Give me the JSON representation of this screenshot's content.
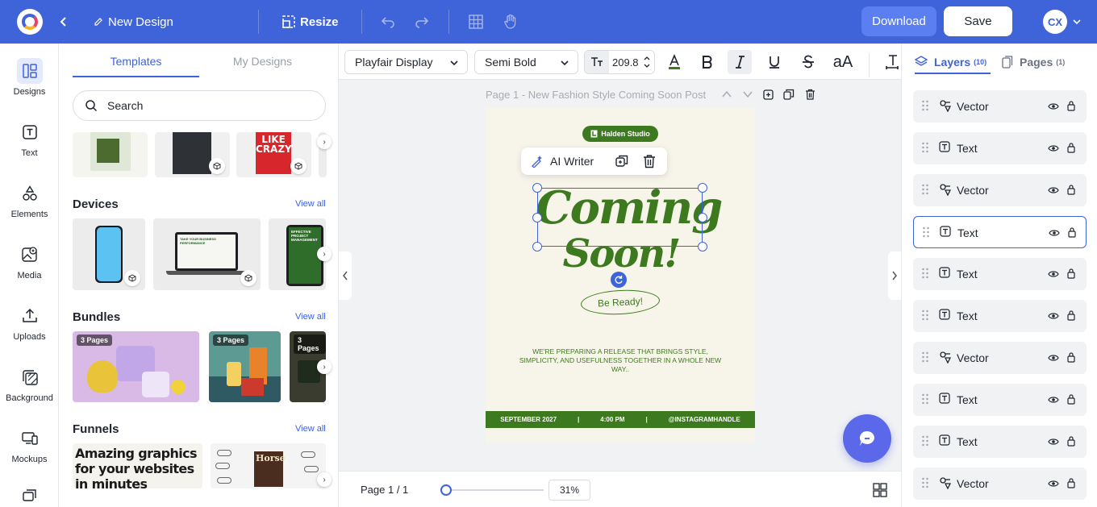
{
  "topbar": {
    "title": "New Design",
    "resize_label": "Resize",
    "download_label": "Download",
    "save_label": "Save",
    "avatar_initials": "CX"
  },
  "leftnav": {
    "items": [
      {
        "label": "Designs",
        "icon": "designs-icon"
      },
      {
        "label": "Text",
        "icon": "text-icon"
      },
      {
        "label": "Elements",
        "icon": "elements-icon"
      },
      {
        "label": "Media",
        "icon": "media-icon"
      },
      {
        "label": "Uploads",
        "icon": "upload-icon"
      },
      {
        "label": "Background",
        "icon": "background-icon"
      },
      {
        "label": "Mockups",
        "icon": "mockups-icon"
      }
    ]
  },
  "panel": {
    "tabs": [
      "Templates",
      "My Designs"
    ],
    "search_placeholder": "Search",
    "sections": {
      "devices": "Devices",
      "bundles": "Bundles",
      "funnels": "Funnels",
      "view_all": "View all"
    },
    "book_thumb_text": "LIKE CRAZY",
    "device_texts": [
      "TAKE YOUR BUSINESS PERFORMANCE",
      "EFFECTIVE PROJECT MANAGEMENT"
    ],
    "bundle_badge": "3 Pages",
    "funnel_text_1": "Amazing graphics for your websites in minutes",
    "funnel_text_2": "Horse"
  },
  "toolbar": {
    "font_family": "Playfair Display",
    "font_weight": "Semi Bold",
    "font_size": "209.8",
    "case_label": "aA"
  },
  "canvas": {
    "page_label": "Page 1 - New Fashion Style Coming Soon Post",
    "ai_writer_label": "AI Writer",
    "poster": {
      "studio": "Halden Studio",
      "line1": "Coming",
      "line2": "Soon!",
      "ready": "Be Ready!",
      "description": "WE'RE PREPARING A RELEASE THAT BRINGS STYLE, SIMPLICITY, AND USEFULNESS TOGETHER IN A WHOLE NEW WAY..",
      "footer": [
        "SEPTEMBER 2027",
        "|",
        "4:00 PM",
        "|",
        "@INSTAGRAMHANDLE"
      ]
    },
    "accent_green": "#3d7a1f"
  },
  "bottombar": {
    "page_indicator": "Page 1 / 1",
    "zoom": "31%",
    "zoom_fraction": 0.31
  },
  "rpanel": {
    "layers_tab": "Layers",
    "layers_count": "(10)",
    "pages_tab": "Pages",
    "pages_count": "(1)",
    "layers": [
      {
        "name": "Vector",
        "type": "vector"
      },
      {
        "name": "Text",
        "type": "text"
      },
      {
        "name": "Vector",
        "type": "vector"
      },
      {
        "name": "Text",
        "type": "text",
        "selected": true
      },
      {
        "name": "Text",
        "type": "text"
      },
      {
        "name": "Text",
        "type": "text"
      },
      {
        "name": "Vector",
        "type": "vector"
      },
      {
        "name": "Text",
        "type": "text"
      },
      {
        "name": "Text",
        "type": "text"
      },
      {
        "name": "Vector",
        "type": "vector"
      }
    ]
  },
  "colors": {
    "brand": "#3f63d8",
    "chat": "#5b68ea"
  }
}
